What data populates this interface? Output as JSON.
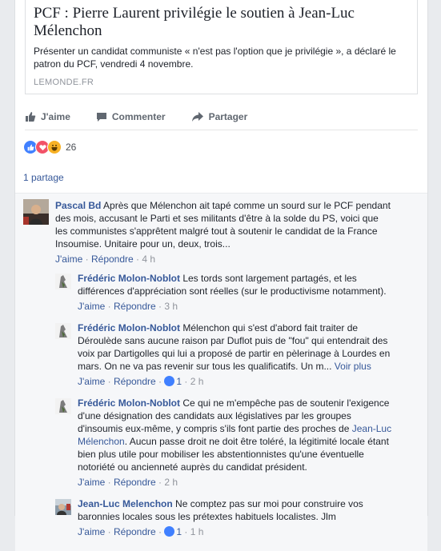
{
  "post": {
    "link": {
      "title": "PCF : Pierre Laurent privilégie le soutien à Jean-Luc Mélenchon",
      "description": "Présenter un candidat communiste « n'est pas l'option que je privilégie », a déclaré le patron du PCF, vendredi 4 novembre.",
      "domain": "LEMONDE.FR"
    },
    "actions": {
      "like": "J'aime",
      "comment": "Commenter",
      "share": "Partager"
    },
    "reactions": {
      "count": "26"
    },
    "shares": "1 partage"
  },
  "comment": {
    "author": "Pascal Bd",
    "text": " Après que Mélenchon ait tapé comme un sourd sur le PCF pendant des mois, accusant le Parti et ses militants d'être à la solde du PS, voici que les communistes s'apprêtent malgré tout à soutenir le candidat de la France Insoumise. Unitaire pour un, deux, trois...",
    "like": "J'aime",
    "reply": "Répondre",
    "time": "4 h"
  },
  "replies": [
    {
      "author": "Frédéric Molon-Noblot",
      "text": " Les tords sont largement partagés, et les différences d'appréciation sont réelles (sur le productivisme notamment).",
      "like": "J'aime",
      "reply": "Répondre",
      "likes": "",
      "time": "3 h"
    },
    {
      "author": "Frédéric Molon-Noblot",
      "text": " Mélenchon qui s'est d'abord fait traiter de Déroulède sans aucune raison par Duflot puis de \"fou\" qui entendrait des voix par Dartigolles qui lui a proposé de partir en pèlerinage à Lourdes en mars. On ne va pas revenir sur tous les qualificatifs. Un m... ",
      "more": "Voir plus",
      "like": "J'aime",
      "reply": "Répondre",
      "likes": "1",
      "time": "2 h"
    },
    {
      "author": "Frédéric Molon-Noblot",
      "text_a": " Ce qui ne m'empêche pas de soutenir l'exigence d'une désignation des candidats aux législatives par les groupes d'insoumis eux-même, y compris s'ils font partie des proches de ",
      "mention": "Jean-Luc Mélenchon",
      "text_b": ". Aucun passe droit ne doit être toléré, la légitimité locale étant bien plus utile pour mobiliser les abstentionnistes qu'une éventuelle notoriété ou ancienneté auprès du candidat président.",
      "like": "J'aime",
      "reply": "Répondre",
      "likes": "",
      "time": "2 h"
    },
    {
      "author": "Jean-Luc Melenchon",
      "text": " Ne comptez pas sur moi pour construire vos baronnies locales sous les prétextes habituels localistes. Jlm",
      "like": "J'aime",
      "reply": "Répondre",
      "likes": "1",
      "time": "1 h"
    }
  ],
  "colors": {
    "link": "#365899",
    "meta": "#90949c",
    "like_blue": "#4080ff"
  }
}
